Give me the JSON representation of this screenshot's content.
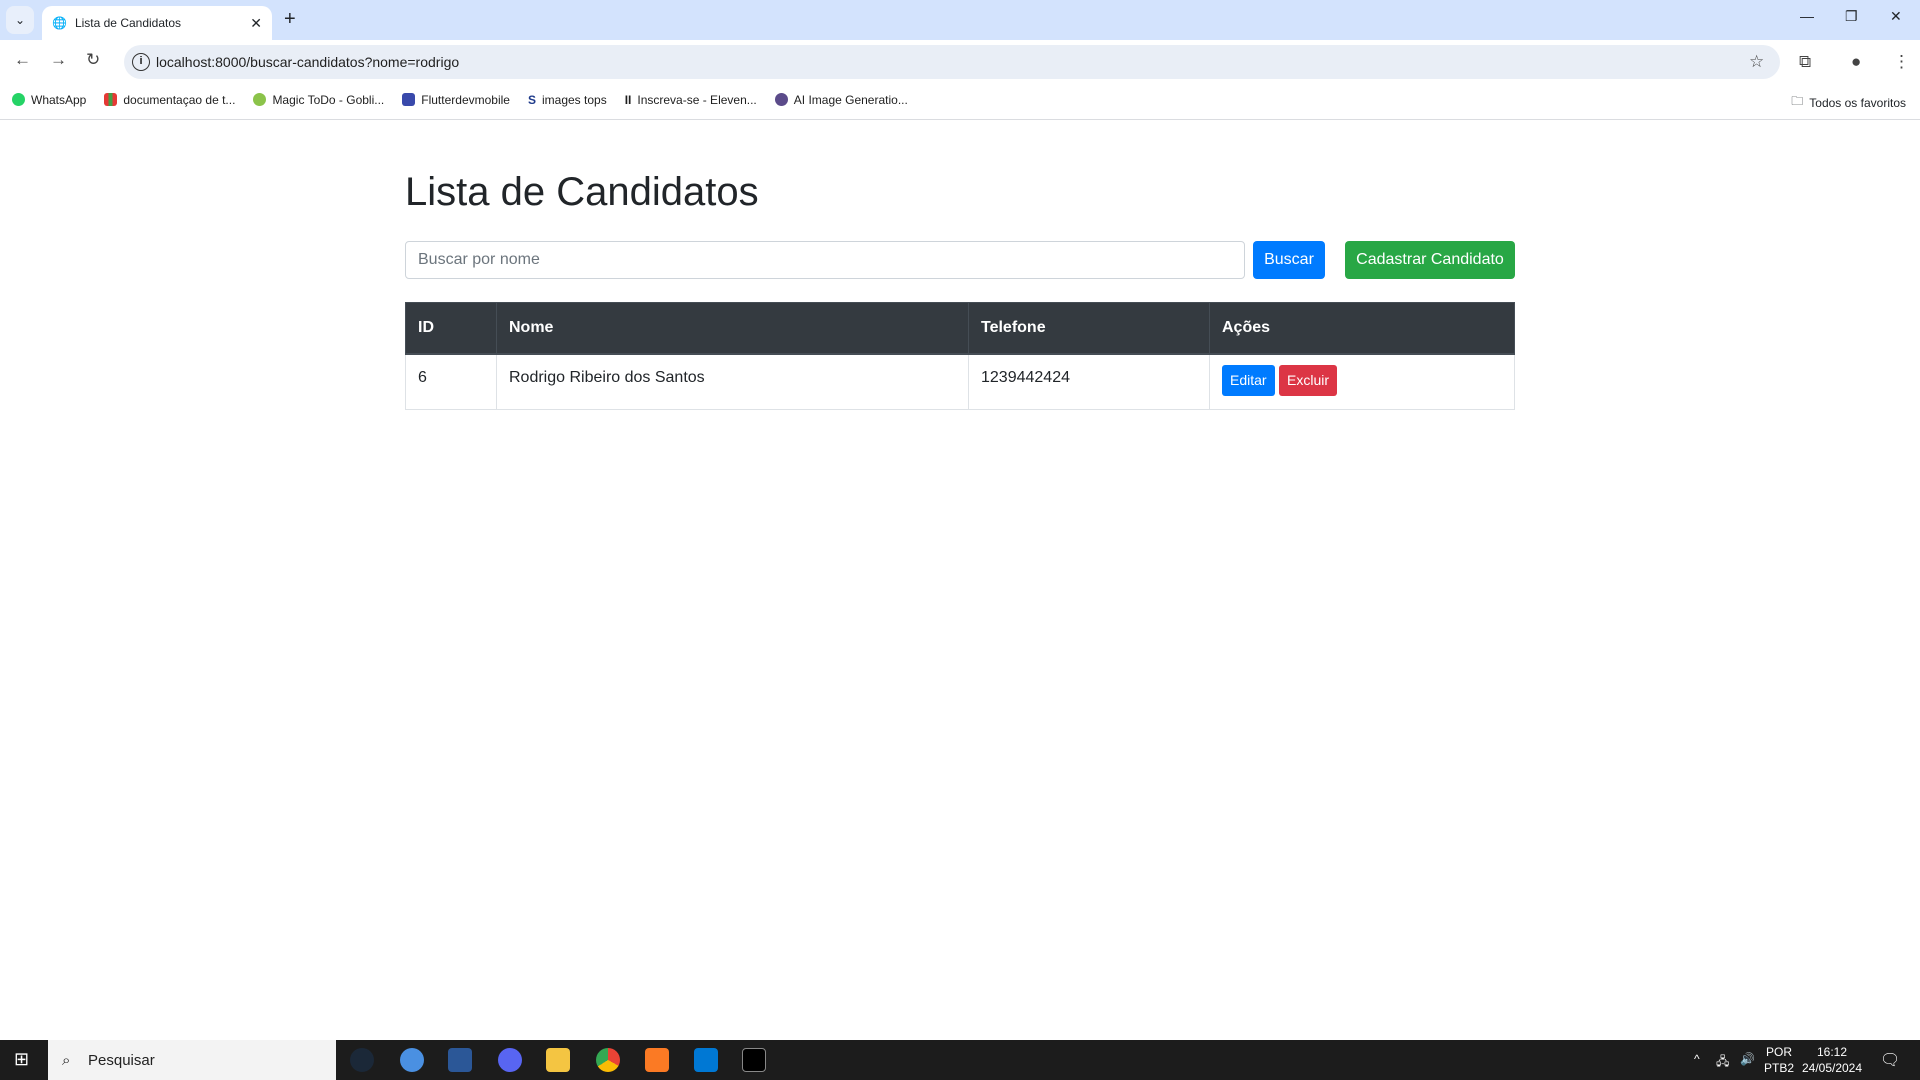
{
  "browser": {
    "tab_title": "Lista de Candidatos",
    "url": "localhost:8000/buscar-candidatos?nome=rodrigo",
    "bookmarks": [
      "WhatsApp",
      "documentaçao de t...",
      "Magic ToDo - Gobli...",
      "Flutterdevmobile",
      "images tops",
      "Inscreva-se - Eleven...",
      "AI Image Generatio..."
    ],
    "all_bookmarks": "Todos os favoritos"
  },
  "page": {
    "title": "Lista de Candidatos",
    "search_placeholder": "Buscar por nome",
    "search_button": "Buscar",
    "add_button": "Cadastrar Candidato",
    "table": {
      "headers": [
        "ID",
        "Nome",
        "Telefone",
        "Ações"
      ],
      "rows": [
        {
          "id": "6",
          "nome": "Rodrigo Ribeiro dos Santos",
          "telefone": "1239442424",
          "edit": "Editar",
          "delete": "Excluir"
        }
      ]
    }
  },
  "taskbar": {
    "search": "Pesquisar",
    "lang1": "POR",
    "lang2": "PTB2",
    "time": "16:12",
    "date": "24/05/2024"
  }
}
